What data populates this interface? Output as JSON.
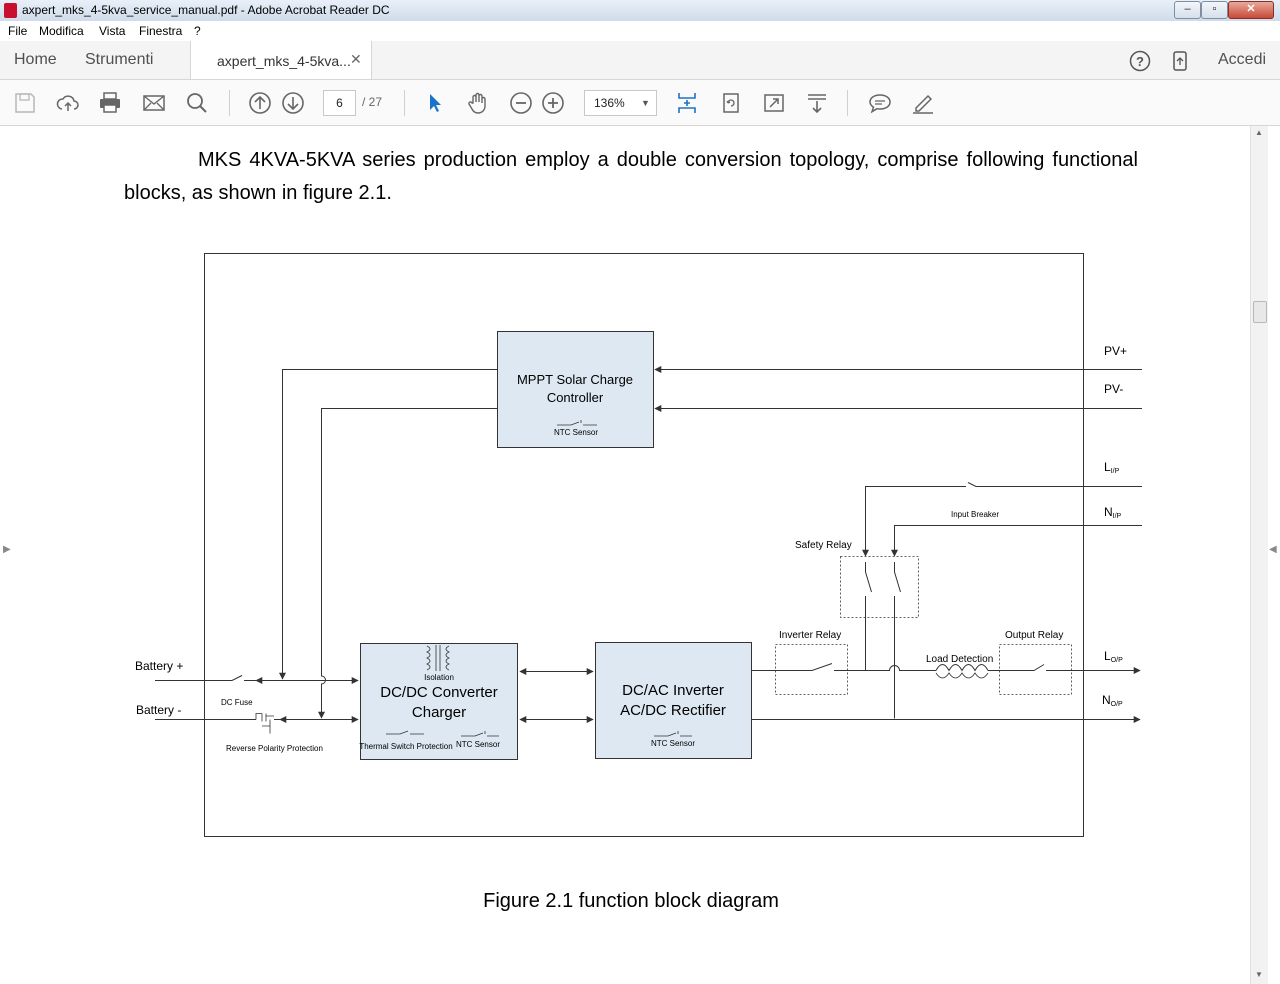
{
  "window": {
    "title": "axpert_mks_4-5kva_service_manual.pdf - Adobe Acrobat Reader DC"
  },
  "menu": {
    "file": "File",
    "edit": "Modifica",
    "view": "Vista",
    "window": "Finestra",
    "help": "?"
  },
  "nav": {
    "home": "Home",
    "tools": "Strumenti",
    "doc_tab": "axpert_mks_4-5kva...",
    "sign_in": "Accedi"
  },
  "toolbar": {
    "page_current": "6",
    "page_total": "/ 27",
    "zoom": "136%"
  },
  "document": {
    "paragraph": "MKS 4KVA-5KVA series production employ a double conversion topology, comprise following functional blocks, as shown in figure 2.1.",
    "caption": "Figure 2.1 function block diagram"
  },
  "diagram": {
    "mppt_line1": "MPPT  Solar Charge",
    "mppt_line2": "Controller",
    "ntc_sensor": "NTC Sensor",
    "dcdc_line1": "DC/DC Converter",
    "dcdc_line2": "Charger",
    "isolation": "Isolation",
    "thermal_switch": "Thermal Switch Protection",
    "inverter_line1": "DC/AC Inverter",
    "inverter_line2": "AC/DC Rectifier",
    "pv_plus": "PV+",
    "pv_minus": "PV-",
    "l_in": "L",
    "l_in_sub": "I/P",
    "n_in": "N",
    "n_in_sub": "I/P",
    "input_breaker": "Input Breaker",
    "safety_relay": "Safety Relay",
    "inverter_relay": "Inverter Relay",
    "load_detection": "Load Detection",
    "output_relay": "Output Relay",
    "l_out": "L",
    "l_out_sub": "O/P",
    "n_out": "N",
    "n_out_sub": "O/P",
    "battery_plus": "Battery +",
    "battery_minus": "Battery -",
    "dc_fuse": "DC Fuse",
    "reverse_polarity": "Reverse Polarity Protection"
  }
}
